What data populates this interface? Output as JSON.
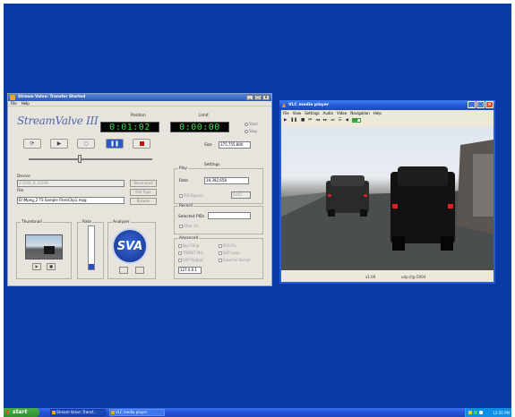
{
  "desktop": {
    "background": "#0a3aa6"
  },
  "streamvalve": {
    "title": "Stream Valve: Transfer Started",
    "menu": [
      "File",
      "Help"
    ],
    "logo": "StreamValve III",
    "position_label": "Position",
    "position_time": "0:01:02",
    "limit_label": "Limit",
    "limit_time": "0:00:00",
    "radio_start": "Start",
    "radio_stop": "Stop",
    "size_label": "Size",
    "size_value": "375,755,800",
    "device_label": "Device",
    "device_value": "Z:\\DVB_B_S\\DVB",
    "file_label": "File",
    "file_value": "D:\\Mpeg_2 TS Sample Files\\Clip1.mpg",
    "btn_reconnect": "Reconnect",
    "btn_file_type": "File Type",
    "btn_browse": "Browse",
    "settings_label": "Settings",
    "play_label": "Play",
    "rate_label": "Rate",
    "rate_value": "19,392,658",
    "pid_bypass": "PID Bypass",
    "pid_value": "0x00",
    "record_label": "Record",
    "selected_pids_label": "Selected PIDs",
    "filter_label": "Filter On",
    "advanced_label": "Advanced",
    "adv_options": [
      "Null Strip",
      "TS/M2T Mix",
      "SAP Output",
      "PCR Fix",
      "SAP Loop",
      "External Server"
    ],
    "ip_value": "127.0.0.1",
    "thumbnail_label": "Thumbnail",
    "rate_meter_label": "Rate",
    "rate_meter_level": 0.12,
    "analyzer_label": "Analyzer",
    "sva_logo": "SVA"
  },
  "vlc": {
    "title": "VLC media player",
    "menu": [
      "File",
      "View",
      "Settings",
      "Audio",
      "Video",
      "Navigation",
      "Help"
    ],
    "volume_label": "100",
    "status_speed": "x1.00",
    "status_file": "udp://@:5004"
  },
  "taskbar": {
    "start_label": "start",
    "tasks": [
      "Stream Valve: Transf...",
      "VLC media player"
    ],
    "clock": "12:35 PM"
  }
}
